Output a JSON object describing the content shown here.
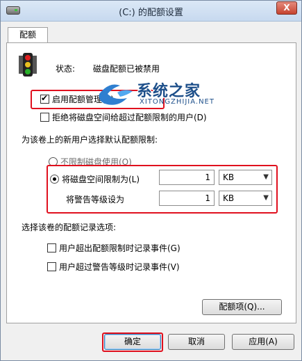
{
  "window": {
    "title": "(C:) 的配额设置",
    "close_label": "X"
  },
  "tab": {
    "label": "配额"
  },
  "status": {
    "label": "状态:",
    "value": "磁盘配额已被禁用"
  },
  "options": {
    "enable_quota": {
      "label": "启用配额管理(E)",
      "checked": true
    },
    "deny_space": {
      "label": "拒绝将磁盘空间给超过配额限制的用户(D)",
      "checked": false
    },
    "default_limit_label": "为该卷上的新用户选择默认配额限制:",
    "no_limit": {
      "label": "不限制磁盘使用(O)"
    },
    "limit_to": {
      "label": "将磁盘空间限制为(L)",
      "value": "1",
      "unit": "KB"
    },
    "warning_level": {
      "label": "将警告等级设为",
      "value": "1",
      "unit": "KB"
    }
  },
  "logging": {
    "label": "选择该卷的配额记录选项:",
    "over_limit": {
      "label": "用户超出配额限制时记录事件(G)"
    },
    "over_warning": {
      "label": "用户超过警告等级时记录事件(V)"
    }
  },
  "buttons": {
    "quota_entries": "配额项(Q)...",
    "ok": "确定",
    "cancel": "取消",
    "apply": "应用(A)"
  },
  "watermark": {
    "title": "系统之家",
    "subtitle": "XITONGZHIJIA.NET"
  },
  "colors": {
    "highlight_box": "#e0101e",
    "title_bar": "#c7d9ef"
  }
}
